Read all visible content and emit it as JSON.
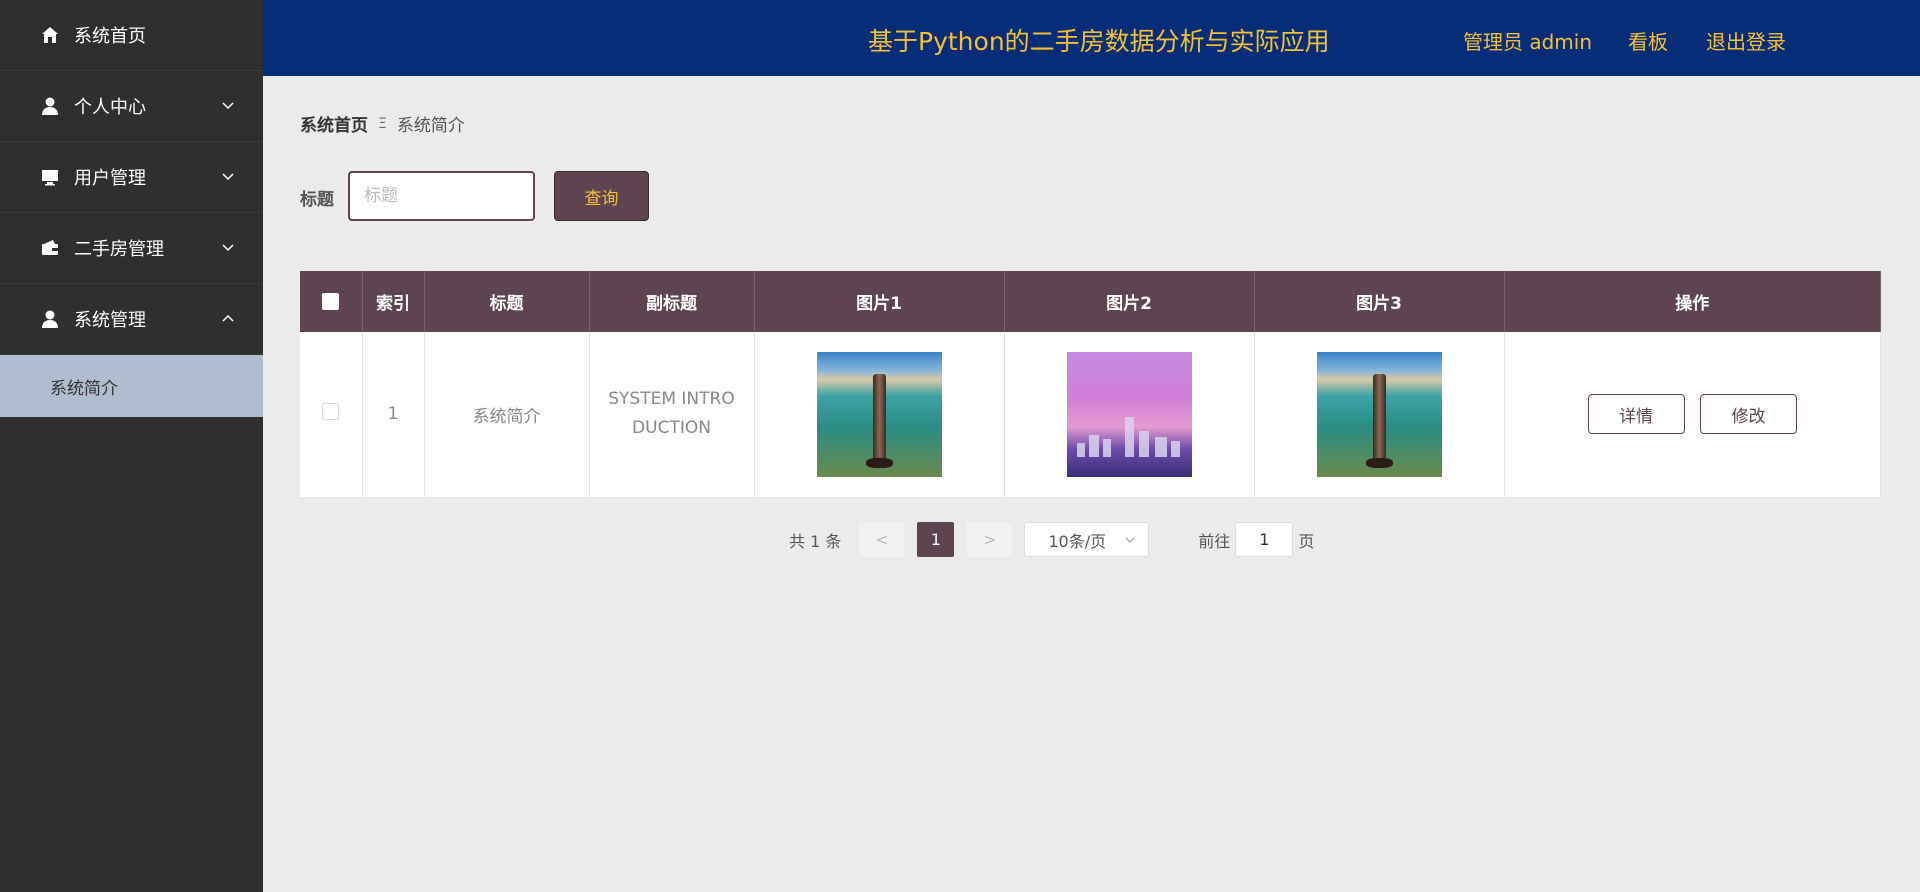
{
  "sidebar": {
    "items": [
      {
        "label": "系统首页",
        "icon": "home-icon",
        "expandable": false
      },
      {
        "label": "个人中心",
        "icon": "user-icon",
        "expandable": true,
        "expanded": false
      },
      {
        "label": "用户管理",
        "icon": "monitor-icon",
        "expandable": true,
        "expanded": false
      },
      {
        "label": "二手房管理",
        "icon": "wallet-icon",
        "expandable": true,
        "expanded": false
      },
      {
        "label": "系统管理",
        "icon": "user-icon",
        "expandable": true,
        "expanded": true
      }
    ],
    "submenu": {
      "label": "系统简介"
    }
  },
  "header": {
    "title": "基于Python的二手房数据分析与实际应用",
    "admin": "管理员 admin",
    "board": "看板",
    "logout": "退出登录"
  },
  "breadcrumb": {
    "home": "系统首页",
    "separator": "Ξ",
    "current": "系统简介"
  },
  "search": {
    "label": "标题",
    "placeholder": "标题",
    "value": "",
    "button": "查询"
  },
  "table": {
    "columns": [
      "索引",
      "标题",
      "副标题",
      "图片1",
      "图片2",
      "图片3",
      "操作"
    ],
    "rows": [
      {
        "index": "1",
        "title": "系统简介",
        "subtitle": "SYSTEM INTRODUCTION",
        "images": [
          "lighthouse-photo",
          "city-skyline-photo",
          "lighthouse-photo"
        ],
        "actions": [
          "详情",
          "修改"
        ]
      }
    ]
  },
  "pagination": {
    "total": "共 1 条",
    "prev": "<",
    "next": ">",
    "current_page": "1",
    "page_size": "10条/页",
    "goto_prefix": "前往",
    "goto_value": "1",
    "goto_suffix": "页"
  },
  "colors": {
    "sidebar_bg": "#2f2f2f",
    "header_bg": "#052d78",
    "accent_gold": "#f5c033",
    "primary": "#5d4450",
    "submenu_active": "#b0bcd0"
  }
}
